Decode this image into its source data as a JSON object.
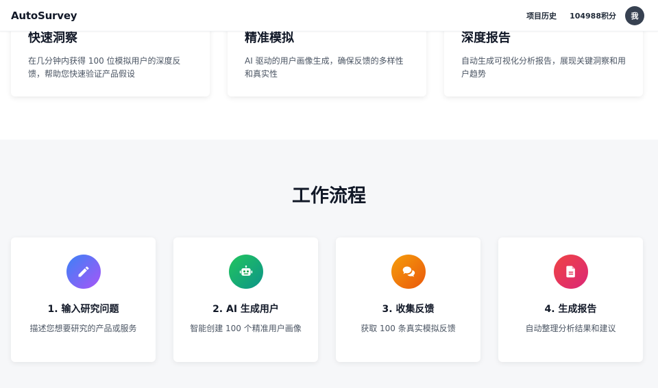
{
  "header": {
    "logo": "AutoSurvey",
    "history_link": "项目历史",
    "points": "104988积分",
    "avatar_text": "我"
  },
  "features": [
    {
      "title": "快速洞察",
      "desc": "在几分钟内获得 100 位模拟用户的深度反馈，帮助您快速验证产品假设"
    },
    {
      "title": "精准模拟",
      "desc": "AI 驱动的用户画像生成，确保反馈的多样性和真实性"
    },
    {
      "title": "深度报告",
      "desc": "自动生成可视化分析报告，展现关键洞察和用户趋势"
    }
  ],
  "workflow": {
    "title": "工作流程",
    "steps": [
      {
        "title": "1. 输入研究问题",
        "desc": "描述您想要研究的产品或服务",
        "icon": "pencil-icon",
        "color_from": "#3b82f6",
        "color_to": "#a855f7"
      },
      {
        "title": "2. AI 生成用户",
        "desc": "智能创建 100 个精准用户画像",
        "icon": "robot-icon",
        "color_from": "#22c55e",
        "color_to": "#0d9488"
      },
      {
        "title": "3. 收集反馈",
        "desc": "获取 100 条真实模拟反馈",
        "icon": "chat-bubbles-icon",
        "color_from": "#f59e0b",
        "color_to": "#ea580c"
      },
      {
        "title": "4. 生成报告",
        "desc": "自动整理分析结果和建议",
        "icon": "document-icon",
        "color_from": "#ef4444",
        "color_to": "#db2777"
      }
    ]
  }
}
